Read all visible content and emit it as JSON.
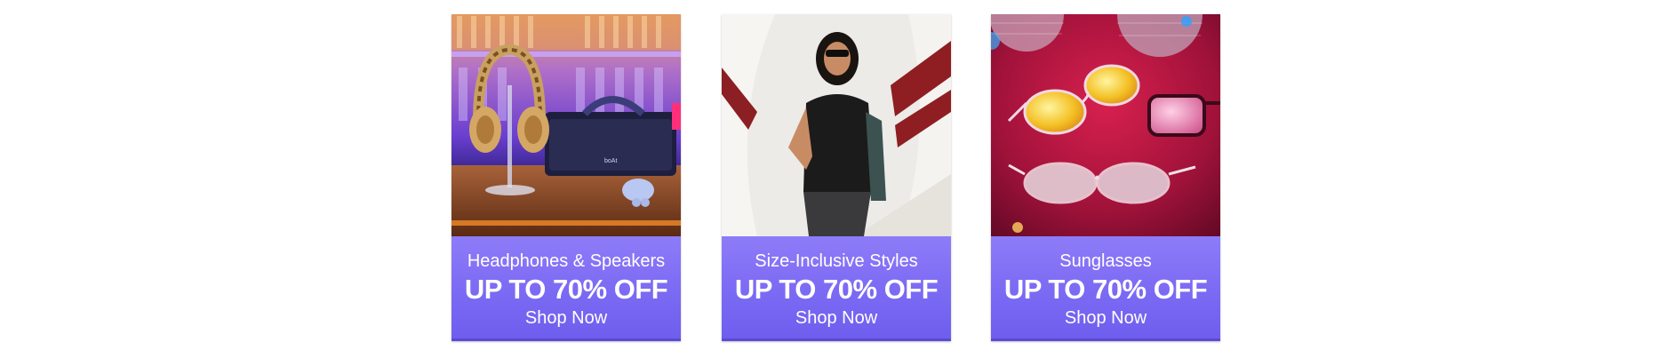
{
  "promo_cards": [
    {
      "title": "Headphones & Speakers",
      "offer": "UP TO 70% OFF",
      "cta": "Shop Now"
    },
    {
      "title": "Size-Inclusive Styles",
      "offer": "UP TO 70% OFF",
      "cta": "Shop Now"
    },
    {
      "title": "Sunglasses",
      "offer": "UP TO 70% OFF",
      "cta": "Shop Now"
    }
  ],
  "colors": {
    "banner_purple": "#7b6af3",
    "banner_text": "#ffffff"
  }
}
